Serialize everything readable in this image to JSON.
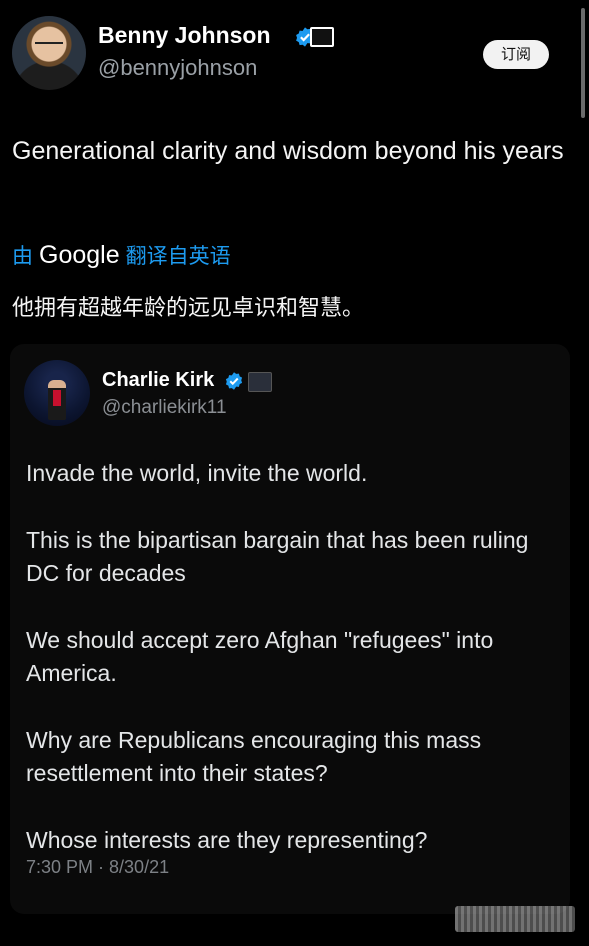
{
  "author": {
    "name": "Benny Johnson",
    "handle": "@bennyjohnson",
    "subscribe_label": "订阅"
  },
  "tweet": {
    "text": "Generational clarity and wisdom beyond his years",
    "translation_prefix": "由",
    "translation_brand": "Google",
    "translation_suffix": "翻译自英语",
    "translated_text": "他拥有超越年龄的远见卓识和智慧。"
  },
  "quote": {
    "name": "Charlie Kirk",
    "handle": "@charliekirk11",
    "paragraphs": [
      "Invade the world, invite the world.",
      "This is the bipartisan bargain that has been ruling DC for decades",
      "We should accept zero Afghan \"refugees\" into America.",
      "Why are Republicans encouraging this mass resettlement into their states?",
      "Whose interests are they representing?"
    ],
    "timestamp": "7:30 PM · 8/30/21"
  },
  "colors": {
    "background": "#000000",
    "verified_blue": "#1d9bf0",
    "translate_blue": "#1d9bf0"
  },
  "icons": {
    "verified": "verified-badge-icon",
    "org_badge": "affiliation-badge-icon"
  }
}
